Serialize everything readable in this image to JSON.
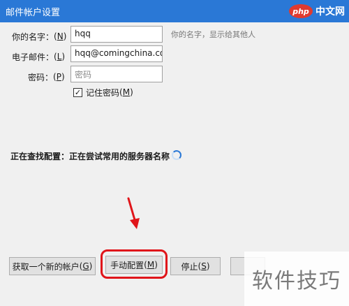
{
  "window": {
    "title": "邮件帐户设置"
  },
  "watermark_top": {
    "logo": "php",
    "text": "中文网"
  },
  "form": {
    "name_label": "你的名字：",
    "name_key": "N",
    "name_value": "hqq",
    "name_hint": "你的名字，显示给其他人",
    "email_label": "电子邮件：",
    "email_key": "L",
    "email_value": "hqq@comingchina.com",
    "password_label": "密码：",
    "password_key": "P",
    "password_placeholder": "密码",
    "remember_label": "记住密码",
    "remember_key": "M",
    "remember_checked": true
  },
  "status": {
    "text": "正在查找配置：正在尝试常用的服务器名称"
  },
  "buttons": {
    "new_account": "获取一个新的帐户",
    "new_account_key": "G",
    "manual_config": "手动配置",
    "manual_config_key": "M",
    "stop": "停止",
    "stop_key": "S"
  },
  "watermark_bottom": {
    "text": "软件技巧"
  },
  "colors": {
    "titlebar": "#2a78d6",
    "highlight": "#e0151a",
    "window_bg": "#f0f0f0"
  }
}
